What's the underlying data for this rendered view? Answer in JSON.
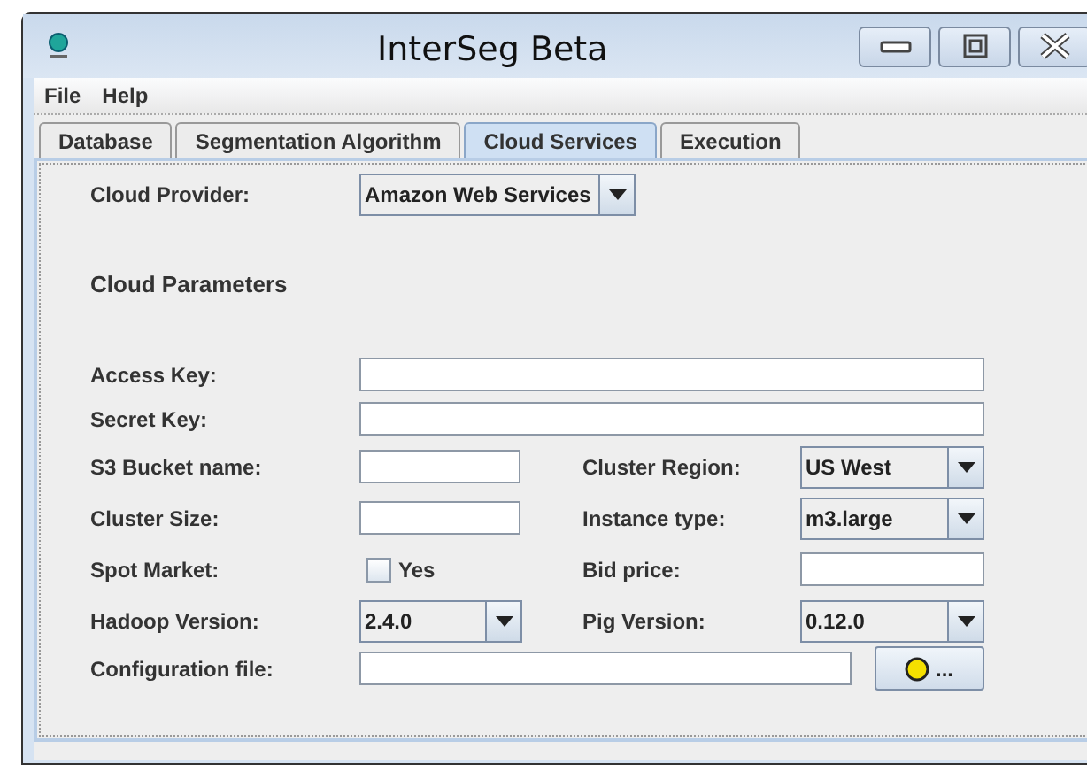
{
  "window": {
    "title": "InterSeg Beta"
  },
  "menu": [
    "File",
    "Help"
  ],
  "tabs": [
    {
      "label": "Database",
      "selected": false
    },
    {
      "label": "Segmentation Algorithm",
      "selected": false
    },
    {
      "label": "Cloud Services",
      "selected": true
    },
    {
      "label": "Execution",
      "selected": false
    }
  ],
  "cloud_provider": {
    "label": "Cloud Provider:",
    "value": "Amazon Web Services"
  },
  "section_title": "Cloud Parameters",
  "rows": [
    {
      "fields": [
        {
          "label": "Access Key:",
          "kind": "text"
        }
      ]
    },
    {
      "fields": [
        {
          "label": "Secret Key:",
          "kind": "text"
        }
      ]
    },
    {
      "fields": [
        {
          "label": "S3 Bucket name:",
          "kind": "text"
        },
        {
          "label": "Cluster Region:",
          "kind": "dropdown",
          "value": "US West"
        }
      ]
    },
    {
      "fields": [
        {
          "label": "Cluster Size:",
          "kind": "text"
        },
        {
          "label": "Instance type:",
          "kind": "dropdown",
          "value": "m3.large"
        }
      ]
    },
    {
      "fields": [
        {
          "label": "Spot Market:",
          "kind": "checkbox",
          "option": "Yes",
          "checked": false
        },
        {
          "label": "Bid price:",
          "kind": "text"
        }
      ]
    },
    {
      "fields": [
        {
          "label": "Hadoop Version:",
          "kind": "dropdown",
          "value": "2.4.0"
        },
        {
          "label": "Pig Version:",
          "kind": "dropdown",
          "value": "0.12.0"
        }
      ]
    },
    {
      "fields": [
        {
          "label": "Configuration file:",
          "kind": "file",
          "button": "..."
        }
      ]
    }
  ]
}
